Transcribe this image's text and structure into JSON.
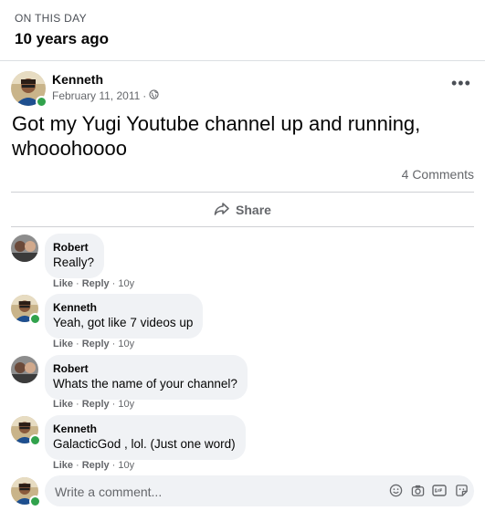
{
  "memory": {
    "eyebrow": "ON THIS DAY",
    "title": "10 years ago"
  },
  "post": {
    "author": "Kenneth",
    "date": "February 11, 2011",
    "separator": "·",
    "privacy_icon": "globe-icon",
    "text": "Got my Yugi Youtube channel up and running, whooohoooo",
    "comments_count": "4 Comments",
    "share_label": "Share"
  },
  "comments": [
    {
      "name": "Robert",
      "text": "Really?",
      "like": "Like",
      "reply": "Reply",
      "sep": "·",
      "age": "10y"
    },
    {
      "name": "Kenneth",
      "text": "Yeah, got like 7 videos up",
      "like": "Like",
      "reply": "Reply",
      "sep": "·",
      "age": "10y"
    },
    {
      "name": "Robert",
      "text": "Whats the name of your channel?",
      "like": "Like",
      "reply": "Reply",
      "sep": "·",
      "age": "10y"
    },
    {
      "name": "Kenneth",
      "text": "GalacticGod , lol. (Just one word)",
      "like": "Like",
      "reply": "Reply",
      "sep": "·",
      "age": "10y"
    }
  ],
  "composer": {
    "placeholder": "Write a comment...",
    "icons": [
      "emoji-icon",
      "camera-icon",
      "gif-icon",
      "sticker-icon"
    ]
  },
  "colors": {
    "online": "#31a24c",
    "bubble": "#f0f2f5",
    "secondary_text": "#65676b"
  }
}
